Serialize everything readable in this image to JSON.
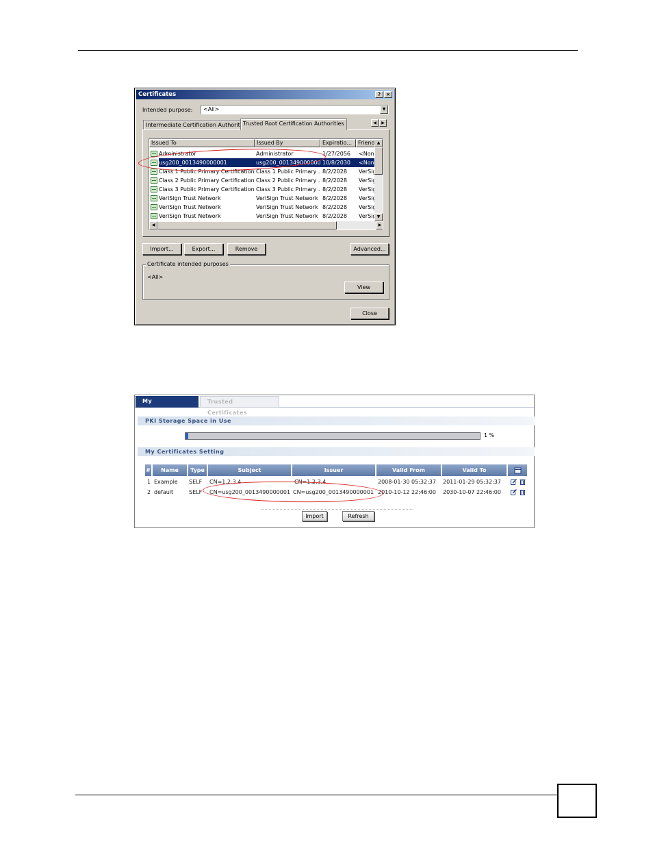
{
  "dialog": {
    "title": "Certificates",
    "help_glyph": "?",
    "close_glyph": "×",
    "purpose_label": "Intended purpose:",
    "purpose_value": "<All>",
    "tabs": [
      "Intermediate Certification Authorities",
      "Trusted Root Certification Authorities"
    ],
    "columns": [
      "Issued To",
      "Issued By",
      "Expiratio...",
      "Friend"
    ],
    "rows": [
      {
        "to": "Administrator",
        "by": "Administrator",
        "exp": "1/27/2056",
        "friendly": "<None"
      },
      {
        "to": "usg200_0013490000001",
        "by": "usg200_0013490000001",
        "exp": "10/8/2030",
        "friendly": "<None"
      },
      {
        "to": "Class 1 Public Primary Certification ...",
        "by": "Class 1 Public Primary ...",
        "exp": "8/2/2028",
        "friendly": "VerSig"
      },
      {
        "to": "Class 2 Public Primary Certification ...",
        "by": "Class 2 Public Primary ...",
        "exp": "8/2/2028",
        "friendly": "VerSig"
      },
      {
        "to": "Class 3 Public Primary Certification ...",
        "by": "Class 3 Public Primary ...",
        "exp": "8/2/2028",
        "friendly": "VerSig"
      },
      {
        "to": "VeriSign Trust Network",
        "by": "VeriSign Trust Network",
        "exp": "8/2/2028",
        "friendly": "VerSig"
      },
      {
        "to": "VeriSign Trust Network",
        "by": "VeriSign Trust Network",
        "exp": "8/2/2028",
        "friendly": "VerSig"
      },
      {
        "to": "VeriSign Trust Network",
        "by": "VeriSign Trust Network",
        "exp": "8/2/2028",
        "friendly": "VerSig"
      }
    ],
    "buttons": {
      "import": "Import...",
      "export": "Export...",
      "remove": "Remove",
      "advanced": "Advanced...",
      "view": "View",
      "close": "Close"
    },
    "group_title": "Certificate intended purposes",
    "group_value": "<All>"
  },
  "web": {
    "tabs": {
      "active": "My Certificates",
      "inactive": "Trusted Certificates"
    },
    "storage_title": "PKI Storage Space in Use",
    "storage_percent": 1,
    "storage_label": "1 %",
    "setting_title": "My Certificates Setting",
    "columns": [
      "#",
      "Name",
      "Type",
      "Subject",
      "Issuer",
      "Valid From",
      "Valid To"
    ],
    "rows": [
      {
        "num": "1",
        "name": "Example",
        "type": "SELF",
        "subject": "CN=1.2.3.4",
        "issuer": "CN=1.2.3.4",
        "from": "2008-01-30 05:32:37",
        "to": "2011-01-29 05:32:37"
      },
      {
        "num": "2",
        "name": "default",
        "type": "SELF",
        "subject": "CN=usg200_0013490000001",
        "issuer": "CN=usg200_0013490000001",
        "from": "2010-10-12 22:46:00",
        "to": "2030-10-07 22:46:00"
      }
    ],
    "buttons": {
      "import": "Import",
      "refresh": "Refresh"
    }
  },
  "colors": {
    "highlight": "#d82020",
    "selection": "#0a246a",
    "web_header": "#1d3b7a"
  }
}
